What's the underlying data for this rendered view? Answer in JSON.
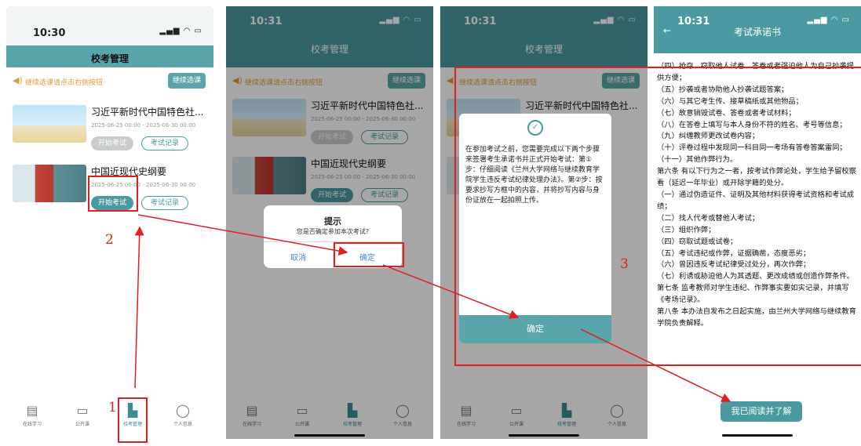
{
  "screens": [
    {
      "time": "10:30",
      "title": "校考管理",
      "notice": "继续选课请点击右侧按钮",
      "notice_button": "继续选课",
      "courses": [
        {
          "title": "习近平新时代中国特色社...",
          "date": "2025-06-25 00:00 - 2025-06-30 00:00",
          "start": "开始考试",
          "record": "考试记录"
        },
        {
          "title": "中国近现代史纲要",
          "date": "2025-06-25 00:00 - 2025-06-30 00:00",
          "start": "开始考试",
          "record": "考试记录"
        }
      ],
      "tabs": [
        "在线学习",
        "公开课",
        "校考管理",
        "个人信息"
      ]
    },
    {
      "time": "10:31",
      "title": "校考管理",
      "dialog": {
        "title": "提示",
        "message": "您是否确定参加本次考试?",
        "cancel": "取消",
        "confirm": "确定"
      }
    },
    {
      "time": "10:31",
      "title": "校考管理",
      "modal": {
        "text": "在参加考试之前，您需要完成以下两个步骤来签署考生承诺书并正式开始考试：第①步：仔细阅读《兰州大学网络与继续教育学院学生违反考试纪律处理办法》。第②步：按要求抄写方框中的内容，并将抄写内容与身份证放在一起拍照上传。",
        "button": "确定"
      }
    },
    {
      "time": "10:31",
      "title": "考试承诺书",
      "lines": [
        "（四）抢夺、窃取他人试卷、答卷或者强迫他人为自己抄袭提供方便；",
        "（五）抄袭或者协助他人抄袭试题答案；",
        "（六）与其它考生传、接草稿纸或其他物品；",
        "（七）故意销毁试卷、答卷或者考试材料；",
        "（八）在答卷上填写与本人身份不符的姓名、考号等信息；",
        "（九）纠缠教师更改试卷内容；",
        "（十）评卷过程中发现同一科目同一考场有答卷答案雷同；",
        "（十一）其他作弊行为。",
        "第六条 有以下行为之一者，按考试作弊论处，学生给予留校察看（延迟一年毕业）或开除学籍的处分。",
        "（一）通过伪造证件、证明及其他材料获得考试资格和考试成绩；",
        "（二）找人代考或替他人考试；",
        "（三）组织作弊；",
        "（四）窃取试题或试卷；",
        "（五）考试违纪或作弊，证据确凿，态度恶劣；",
        "（六）曾因违反考试纪律受过处分，再次作弊；",
        "（七）利诱或胁迫他人为其透题、更改成绩或创造作弊条件。",
        "第七条 监考教师对学生违纪、作弊事实要如实记录，并填写《考场记录》。",
        "第八条 本办法自发布之日起实施，由兰州大学网络与继续教育学院负责解释。"
      ],
      "button": "我已阅读并了解"
    }
  ],
  "step_labels": [
    "1",
    "2",
    "3"
  ],
  "colors": {
    "primary": "#4b9aa1",
    "annotation": "#e02020",
    "notice": "#e49a3a"
  }
}
